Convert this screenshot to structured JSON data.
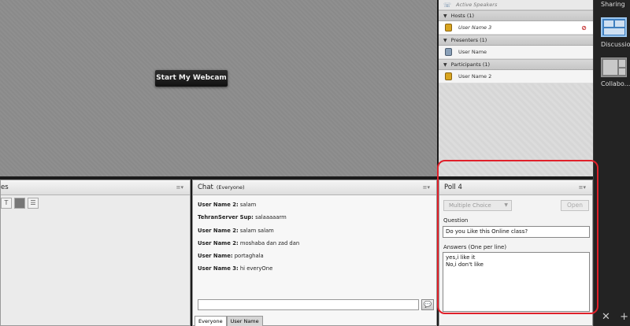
{
  "stage": {
    "webcam_button": "Start My Webcam"
  },
  "attendees": {
    "active_speakers": "Active Speakers",
    "hosts_header": "Hosts (1)",
    "hosts": [
      "User Name 3"
    ],
    "presenters_header": "Presenters (1)",
    "presenters": [
      "User Name"
    ],
    "participants_header": "Participants (1)",
    "participants": [
      "User Name 2"
    ]
  },
  "sidebar": {
    "sharing": "Sharing",
    "discussion": "Discussion",
    "collaboration": "Collabo..."
  },
  "left_panel": {
    "title_fragment": "es"
  },
  "chat": {
    "title": "Chat",
    "scope": "(Everyone)",
    "messages": [
      {
        "sender": "User Name 2:",
        "text": " salam"
      },
      {
        "sender": "TehranServer Sup:",
        "text": " salaaaaarm"
      },
      {
        "sender": "User Name 2:",
        "text": " salam salam"
      },
      {
        "sender": "User Name 2:",
        "text": " moshaba dan zad dan"
      },
      {
        "sender": "User Name:",
        "text": " portaghala"
      },
      {
        "sender": "User Name 3:",
        "text": " hi everyOne"
      }
    ],
    "tabs": [
      "Everyone",
      "User Name"
    ]
  },
  "poll": {
    "title": "Poll 4",
    "type_select": "Multiple Choice",
    "open_button": "Open",
    "question_label": "Question",
    "question_value": "Do you Like this Online class?",
    "answers_label": "Answers (One per line)",
    "answers": [
      "yes,i like it",
      "No,i don't like"
    ]
  },
  "colors": {
    "highlight": "#e0202a",
    "selected_layout": "#3f7fbf"
  }
}
